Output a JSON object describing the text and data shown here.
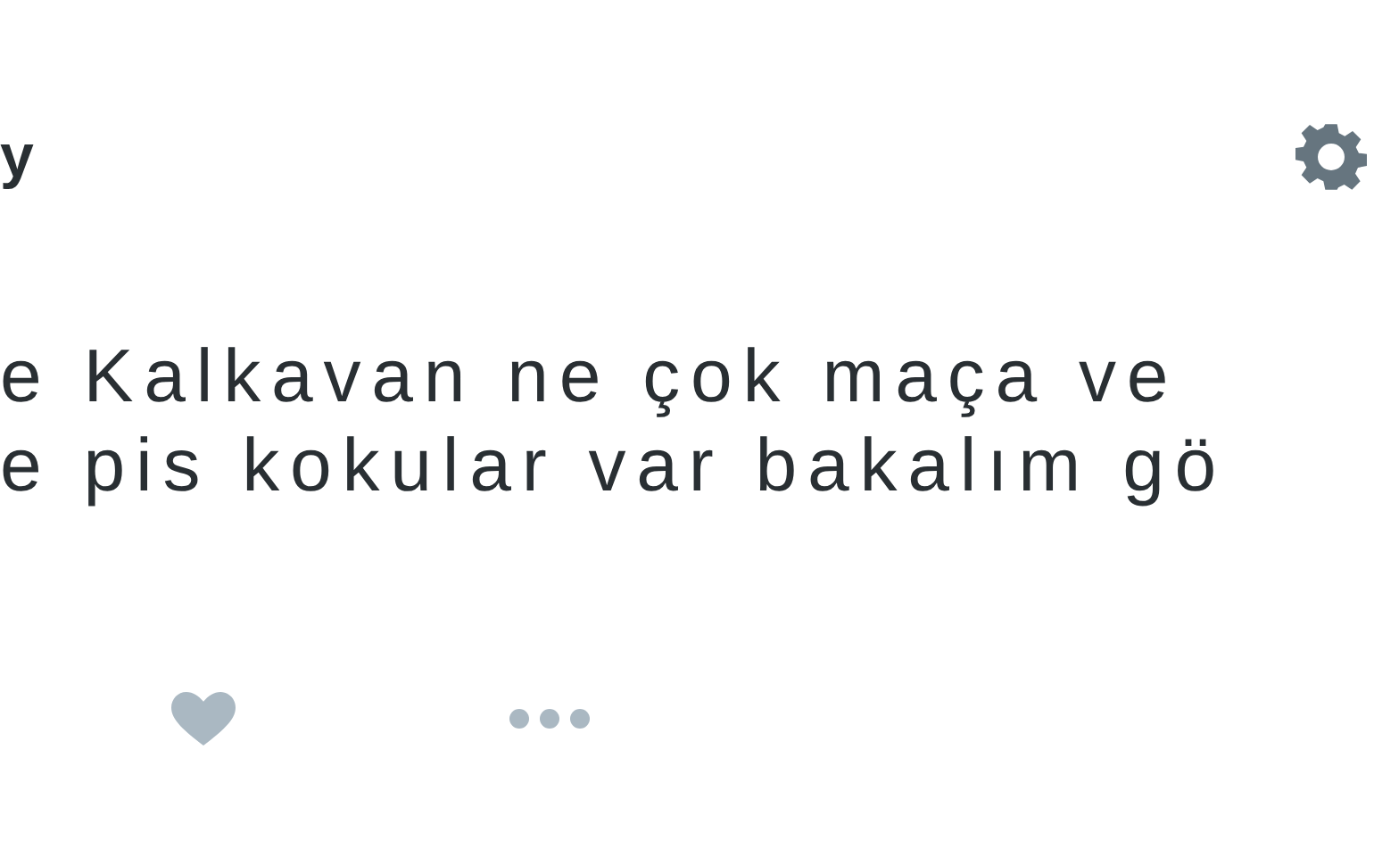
{
  "header": {
    "name_fragment": "y"
  },
  "tweet": {
    "lines": [
      "e Kalkavan ne çok maça ve",
      "e pis kokular var bakalım gö"
    ]
  }
}
